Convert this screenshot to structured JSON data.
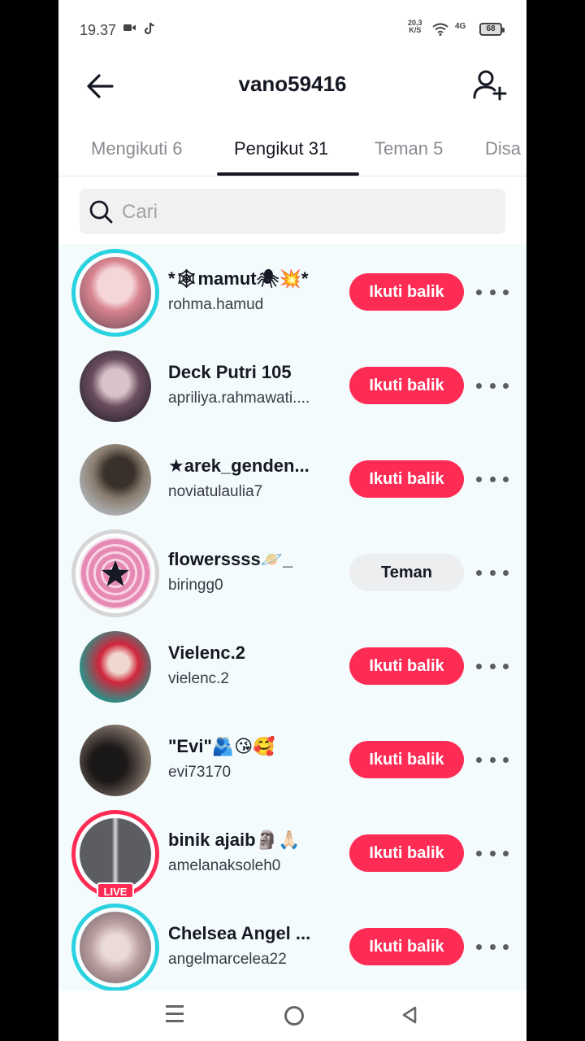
{
  "status": {
    "time": "19.37",
    "net_speed_top": "20,3",
    "net_speed_bottom": "K/S",
    "signal": "4G",
    "battery": "68"
  },
  "header": {
    "title": "vano59416"
  },
  "tabs": [
    {
      "label": "Mengikuti 6",
      "active": false
    },
    {
      "label": "Pengikut 31",
      "active": true
    },
    {
      "label": "Teman 5",
      "active": false
    },
    {
      "label": "Disa",
      "active": false
    }
  ],
  "search": {
    "placeholder": "Cari",
    "value": ""
  },
  "followers": [
    {
      "name": "*🕸mamut🕷💥*",
      "username": "rohma.hamud",
      "action": "Ikuti balik",
      "ring": "story",
      "live": false,
      "avatar_color": "#c98f9b"
    },
    {
      "name": "Deck Putri 105",
      "username": "apriliya.rahmawati....",
      "action": "Ikuti balik",
      "ring": "none",
      "live": false,
      "avatar_color": "#4a3b45"
    },
    {
      "name": "★arek_genden...",
      "username": "noviatulaulia7",
      "action": "Ikuti balik",
      "ring": "none",
      "live": false,
      "avatar_color": "#7a6a5c"
    },
    {
      "name": "flowerssss🪐_",
      "username": "biringg0",
      "action": "Teman",
      "ring": "gray",
      "live": false,
      "avatar_color": "#e28cb1"
    },
    {
      "name": "Vielenc.2",
      "username": "vielenc.2",
      "action": "Ikuti balik",
      "ring": "none",
      "live": false,
      "avatar_color": "#3f8e8a"
    },
    {
      "name": "\"Evi\"🫂😘🥰",
      "username": "evi73170",
      "action": "Ikuti balik",
      "ring": "none",
      "live": false,
      "avatar_color": "#2e2b2b"
    },
    {
      "name": "binik ajaib🗿🙏🏻",
      "username": "amelanaksoleh0",
      "action": "Ikuti balik",
      "ring": "live",
      "live": true,
      "live_label": "LIVE",
      "avatar_color": "#8f8f96"
    },
    {
      "name": "Chelsea Angel ...",
      "username": "angelmarcelea22",
      "action": "Ikuti balik",
      "ring": "story",
      "live": false,
      "avatar_color": "#c9b1b4"
    }
  ],
  "icons": {
    "back": "back-arrow-icon",
    "add_user": "add-user-icon",
    "search": "search-icon",
    "more": "more-dots-icon"
  }
}
